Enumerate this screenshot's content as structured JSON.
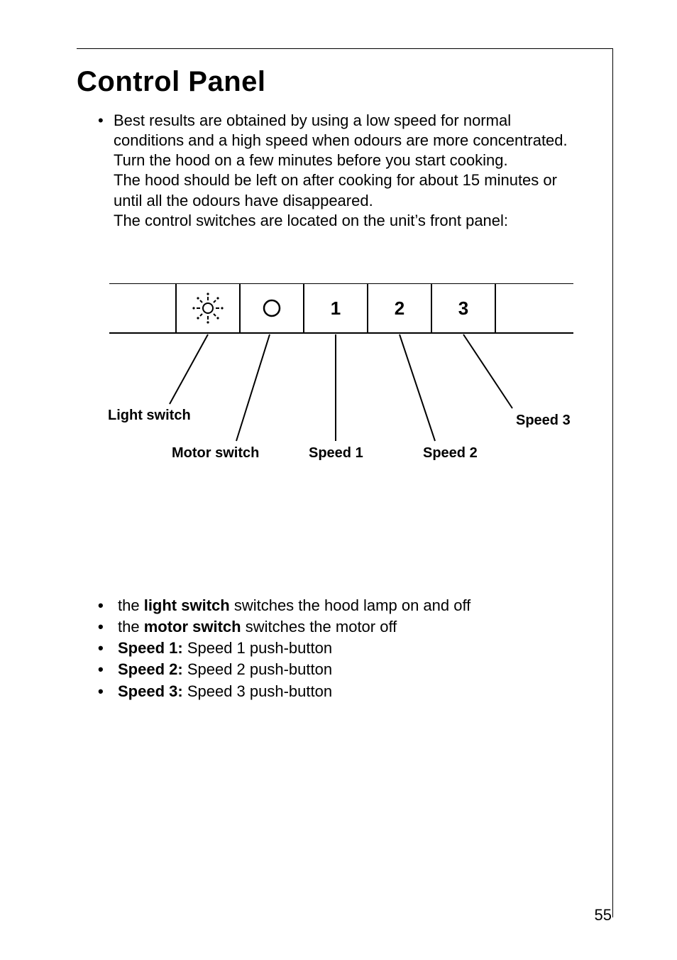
{
  "title": "Control Panel",
  "intro": {
    "lines": [
      "Best results are obtained by using a low speed for normal",
      "conditions and a high speed when odours are more concentrated.",
      "Turn the hood on a few minutes before you start cooking.",
      "The hood should be left on after cooking for about 15 minutes or",
      "until all the odours have disappeared.",
      "The control switches are located on the unit’s front panel:"
    ]
  },
  "panel": {
    "labels": {
      "light_switch": "Light  switch",
      "motor_switch": "Motor switch",
      "speed1": "Speed 1",
      "speed2": "Speed 2",
      "speed3": "Speed 3"
    },
    "buttons": {
      "speed1": "1",
      "speed2": "2",
      "speed3": "3"
    }
  },
  "desc": {
    "light_switch": {
      "pre": "the ",
      "bold": "light switch",
      "post": " switches the hood lamp on and off"
    },
    "motor_switch": {
      "pre": "the ",
      "bold": "motor switch",
      "post": " switches the motor off"
    },
    "speed1": {
      "bold": "Speed 1:",
      "post": " Speed 1 push-button"
    },
    "speed2": {
      "bold": "Speed 2:",
      "post": " Speed 2 push-button"
    },
    "speed3": {
      "bold": "Speed 3:",
      "post": " Speed 3 push-button"
    }
  },
  "page_number": "55"
}
